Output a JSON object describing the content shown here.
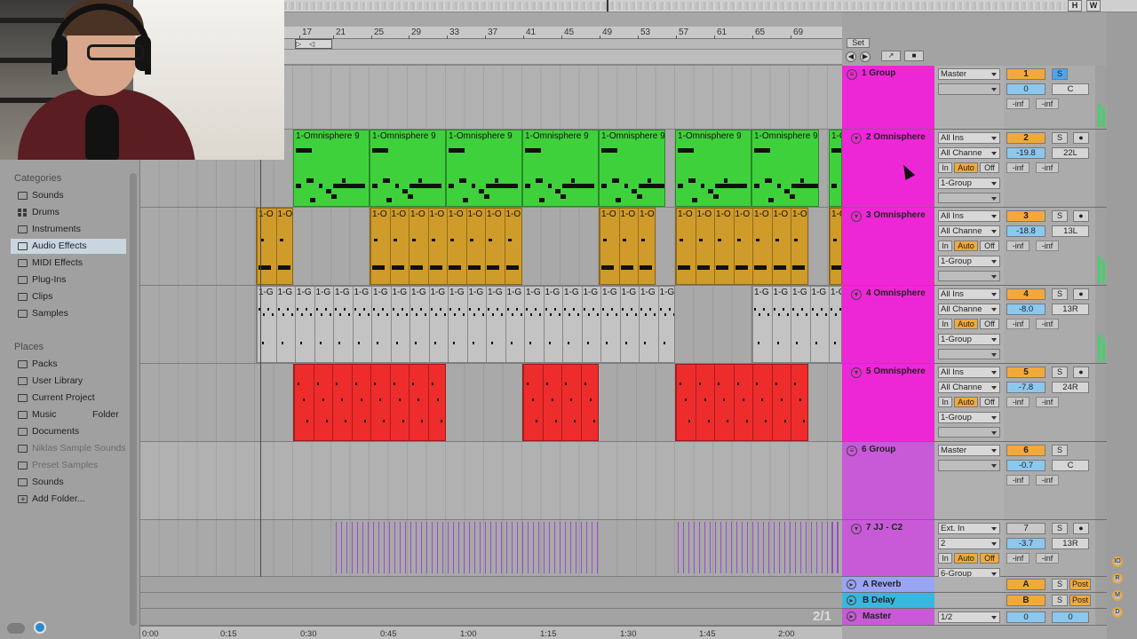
{
  "overview": {
    "buttons": [
      "H",
      "W"
    ]
  },
  "browser": {
    "categories_heading": "Categories",
    "categories": [
      {
        "label": "Sounds",
        "icon": "speaker-icon"
      },
      {
        "label": "Drums",
        "icon": "drums-grid-icon"
      },
      {
        "label": "Instruments",
        "icon": "instrument-icon"
      },
      {
        "label": "Audio Effects",
        "icon": "audio-effect-icon",
        "selected": true
      },
      {
        "label": "MIDI Effects",
        "icon": "midi-effect-icon"
      },
      {
        "label": "Plug-Ins",
        "icon": "plugin-icon"
      },
      {
        "label": "Clips",
        "icon": "clip-icon"
      },
      {
        "label": "Samples",
        "icon": "sample-icon"
      }
    ],
    "places_heading": "Places",
    "places": [
      {
        "label": "Packs",
        "icon": "folder-icon"
      },
      {
        "label": "User Library",
        "icon": "folder-icon"
      },
      {
        "label": "Current Project",
        "icon": "folder-icon"
      },
      {
        "label": "Music",
        "icon": "folder-icon",
        "extra": "Folder"
      },
      {
        "label": "Documents",
        "icon": "folder-icon"
      },
      {
        "label": "Niklas Sample Sounds",
        "icon": "folder-icon",
        "dim": true
      },
      {
        "label": "Preset Samples",
        "icon": "folder-icon",
        "dim": true
      },
      {
        "label": "Sounds",
        "icon": "folder-icon"
      },
      {
        "label": "Add Folder...",
        "icon": "add-folder-icon"
      }
    ]
  },
  "ruler": {
    "bars": [
      "17",
      "21",
      "25",
      "29",
      "33",
      "37",
      "41",
      "45",
      "49",
      "53",
      "57",
      "61",
      "65",
      "69"
    ]
  },
  "set_label": "Set",
  "clips": {
    "omnisphere2_name": "1-Omnisphere 9",
    "omnisphere2_name_short": "1-Omnisphere 9",
    "gold_name": "1-O",
    "gray_name": "1-G"
  },
  "tracks": [
    {
      "name": "1 Group",
      "color": "#ee27d6",
      "input": "Master",
      "number": "1",
      "solo": "S",
      "volume": "0",
      "pan": "C",
      "sendA": "-inf",
      "sendB": "-inf"
    },
    {
      "name": "2 Omnisphere",
      "color": "#ee27d6",
      "input": "All Ins",
      "channel": "All Channe",
      "mon_in": "In",
      "mon_auto": "Auto",
      "mon_off": "Off",
      "output": "1-Group",
      "number": "2",
      "solo": "S",
      "volume": "-19.8",
      "pan": "22L",
      "sendA": "-inf",
      "sendB": "-inf"
    },
    {
      "name": "3 Omnisphere",
      "color": "#ee27d6",
      "input": "All Ins",
      "channel": "All Channe",
      "mon_in": "In",
      "mon_auto": "Auto",
      "mon_off": "Off",
      "output": "1-Group",
      "number": "3",
      "solo": "S",
      "volume": "-18.8",
      "pan": "13L",
      "sendA": "-inf",
      "sendB": "-inf"
    },
    {
      "name": "4 Omnisphere",
      "color": "#ee27d6",
      "input": "All Ins",
      "channel": "All Channe",
      "mon_in": "In",
      "mon_auto": "Auto",
      "mon_off": "Off",
      "output": "1-Group",
      "number": "4",
      "solo": "S",
      "volume": "-8.0",
      "pan": "13R",
      "sendA": "-inf",
      "sendB": "-inf"
    },
    {
      "name": "5 Omnisphere",
      "color": "#ee27d6",
      "input": "All Ins",
      "channel": "All Channe",
      "mon_in": "In",
      "mon_auto": "Auto",
      "mon_off": "Off",
      "output": "1-Group",
      "number": "5",
      "solo": "S",
      "volume": "-7.8",
      "pan": "24R",
      "sendA": "-inf",
      "sendB": "-inf"
    },
    {
      "name": "6 Group",
      "color": "#c85ad8",
      "input": "Master",
      "number": "6",
      "solo": "S",
      "volume": "-0.7",
      "pan": "C",
      "sendA": "-inf",
      "sendB": "-inf"
    },
    {
      "name": "7 JJ - C2",
      "color": "#c85ad8",
      "input": "Ext. In",
      "channel": "2",
      "mon_in": "In",
      "mon_auto": "Auto",
      "mon_off": "Off",
      "output": "6-Group",
      "number": "7",
      "solo": "S",
      "volume": "-3.7",
      "pan": "13R",
      "sendA": "-inf",
      "sendB": "-inf"
    }
  ],
  "returns": [
    {
      "name": "A Reverb",
      "color": "#9aa4f5",
      "letter": "A",
      "solo": "S",
      "post": "Post"
    },
    {
      "name": "B Delay",
      "color": "#39b7e0",
      "letter": "B",
      "solo": "S",
      "post": "Post"
    }
  ],
  "master": {
    "name": "Master",
    "color": "#c85ad8",
    "output": "1/2",
    "volume": "0",
    "pan": "0"
  },
  "time_signature_display": "2/1",
  "timeline": [
    "0:00",
    "0:15",
    "0:30",
    "0:45",
    "1:00",
    "1:15",
    "1:30",
    "1:45",
    "2:00"
  ],
  "right_dots": [
    "IO",
    "R",
    "M",
    "D"
  ]
}
